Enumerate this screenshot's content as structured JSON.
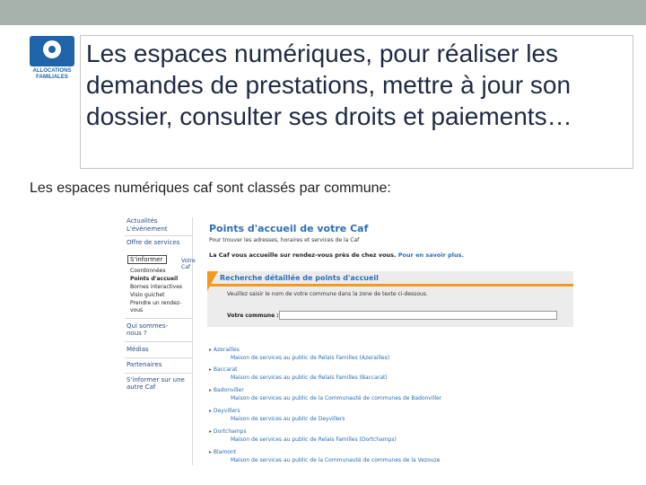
{
  "slide": {
    "title": "Les espaces numériques, pour réaliser les demandes de prestations, mettre à jour son dossier, consulter ses droits et paiements…",
    "subtitle": "Les espaces numériques caf sont classés par commune:",
    "logo_text": "ALLOCATIONS FAMILIALES"
  },
  "colors": {
    "topbar": "#a7b2ac",
    "title": "#1f2a44",
    "caf_blue": "#2f6fb5",
    "accent_orange": "#f39a1e"
  },
  "screenshot": {
    "nav": {
      "items": [
        {
          "label": "Actualités"
        },
        {
          "label": "L'événement"
        },
        {
          "label": "Offre de services"
        },
        {
          "label": "Votre Caf"
        }
      ],
      "select_value": "S'informer",
      "sub_items": [
        "Coordonnées",
        "Points d'accueil",
        "Bornes interactives",
        "Visio guichet",
        "Prendre un rendez-vous"
      ],
      "bottom_items": [
        "Qui sommes-nous ?",
        "Médias",
        "Partenaires",
        "S'informer sur une autre Caf"
      ]
    },
    "main": {
      "title": "Points d'accueil de votre Caf",
      "intro": "Pour trouver les adresses, horaires et services de la Caf",
      "rdv_text": "La Caf vous accueille sur rendez-vous près de chez vous.",
      "rdv_link": "Pour en savoir plus.",
      "search": {
        "title": "Recherche détaillée de points d'accueil",
        "instruction": "Veuillez saisir le nom de votre commune dans la zone de texte ci-dessous.",
        "label": "Votre commune :",
        "value": ""
      },
      "results": [
        {
          "name": "Azerailles",
          "desc": "Maison de services au public de Relais Familles (Azerailles)"
        },
        {
          "name": "Baccarat",
          "desc": "Maison de services au public de Relais Familles (Baccarat)"
        },
        {
          "name": "Badonviller",
          "desc": "Maison de services au public de la Communauté de communes de Badonviller"
        },
        {
          "name": "Deyvillers",
          "desc": "Maison de services au public de Deyvillers"
        },
        {
          "name": "Dortchamps",
          "desc": "Maison de services au public de Relais Familles (Dortchamps)"
        },
        {
          "name": "Blamont",
          "desc": "Maison de services au public de la Communauté de communes de la Vezouze"
        }
      ]
    }
  }
}
